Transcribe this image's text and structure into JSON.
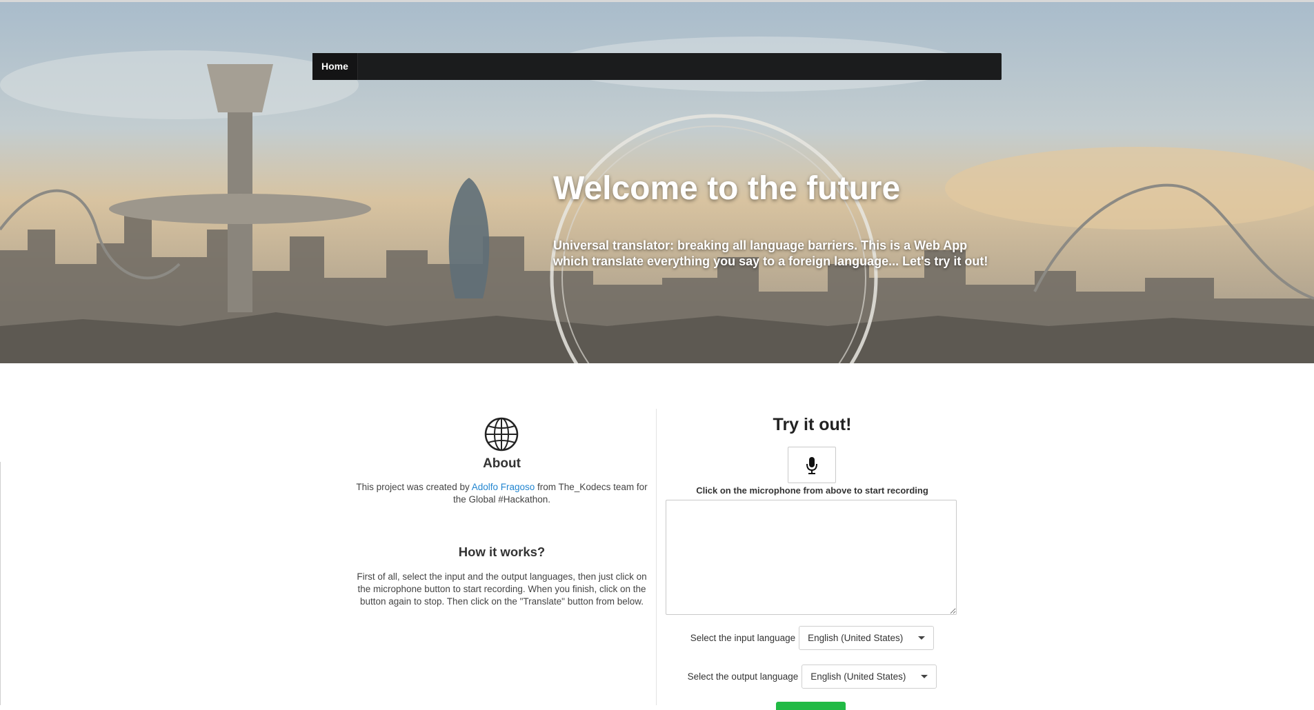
{
  "nav": {
    "home_label": "Home"
  },
  "hero": {
    "title": "Welcome to the future",
    "subtitle": "Universal translator: breaking all language barriers. This is a Web App which translate everything you say to a foreign language... Let's try it out!"
  },
  "about": {
    "icon": "globe-icon",
    "heading": "About",
    "text_before": "This project was created by ",
    "author_link": "Adolfo Fragoso",
    "text_after": " from The_Kodecs team for the Global #Hackathon."
  },
  "how": {
    "heading": "How it works?",
    "text": "First of all, select the input and the output languages, then just click on the microphone button to start recording. When you finish, click on the button again to stop. Then click on the \"Translate\" button from below."
  },
  "try": {
    "heading": "Try it out!",
    "mic_icon": "microphone-icon",
    "hint": "Click on the microphone from above to start recording",
    "textarea_value": "",
    "input_label": "Select the input language",
    "input_value": "English (United States)",
    "output_label": "Select the output language",
    "output_value": "English (United States)"
  },
  "colors": {
    "link": "#2185d0",
    "navbar": "#1b1c1d",
    "button": "#21ba45"
  }
}
